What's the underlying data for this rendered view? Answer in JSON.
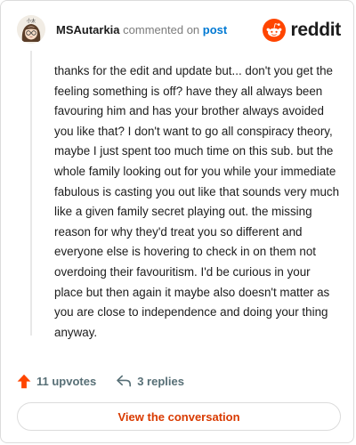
{
  "header": {
    "author": "MSAutarkia",
    "action_text": "commented on",
    "post_link": "post",
    "brand": "reddit",
    "avatar_text": "小太"
  },
  "comment": {
    "text": "thanks for the edit and update but... don't you get the feeling something is off? have they all always been favouring him and has your brother always avoided you like that? I don't want to go all conspiracy theory, maybe I just spent too much time on this sub. but the whole family looking out for you while your immediate fabulous is casting you out like that sounds very much like a given family secret playing out. the missing reason for why they'd treat you so different and everyone else is hovering to check in on them not overdoing their favouritism. I'd be curious in your place but then again it maybe also doesn't matter as you are close to independence and doing your thing anyway."
  },
  "actions": {
    "upvotes": "11 upvotes",
    "replies": "3 replies"
  },
  "footer": {
    "view_label": "View the conversation"
  },
  "colors": {
    "accent": "#ff4500",
    "link": "#0079d3",
    "button_text": "#d93a00",
    "muted": "#576f76"
  },
  "icons": {
    "upvote": "upvote-arrow-icon",
    "reply": "reply-arrow-icon",
    "brand": "reddit-snoo-icon"
  }
}
